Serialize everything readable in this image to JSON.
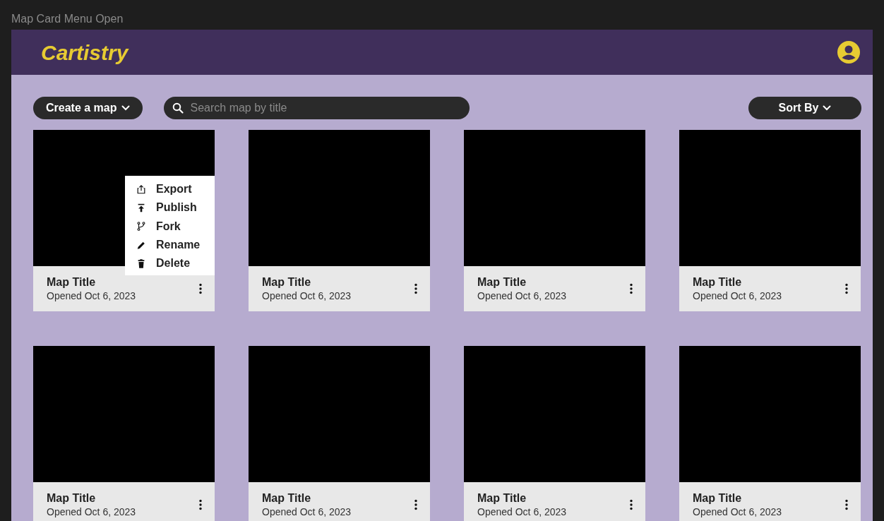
{
  "window": {
    "title": "Map Card Menu Open"
  },
  "header": {
    "logo": "Cartistry"
  },
  "toolbar": {
    "create_button": "Create a map",
    "search": {
      "placeholder": "Search map by title"
    },
    "sort_button": "Sort By"
  },
  "card_menu": {
    "items": [
      {
        "label": "Export",
        "kind": "export"
      },
      {
        "label": "Publish",
        "kind": "publish"
      },
      {
        "label": "Fork",
        "kind": "fork"
      },
      {
        "label": "Rename",
        "kind": "rename"
      },
      {
        "label": "Delete",
        "kind": "delete"
      }
    ]
  },
  "maps": [
    {
      "title": "Map Title",
      "opened": "Opened Oct 6, 2023",
      "menu_open": true
    },
    {
      "title": "Map Title",
      "opened": "Opened Oct 6, 2023"
    },
    {
      "title": "Map Title",
      "opened": "Opened Oct 6, 2023"
    },
    {
      "title": "Map Title",
      "opened": "Opened Oct 6, 2023"
    },
    {
      "title": "Map Title",
      "opened": "Opened Oct 6, 2023"
    },
    {
      "title": "Map Title",
      "opened": "Opened Oct 6, 2023"
    },
    {
      "title": "Map Title",
      "opened": "Opened Oct 6, 2023"
    },
    {
      "title": "Map Title",
      "opened": "Opened Oct 6, 2023"
    }
  ]
}
